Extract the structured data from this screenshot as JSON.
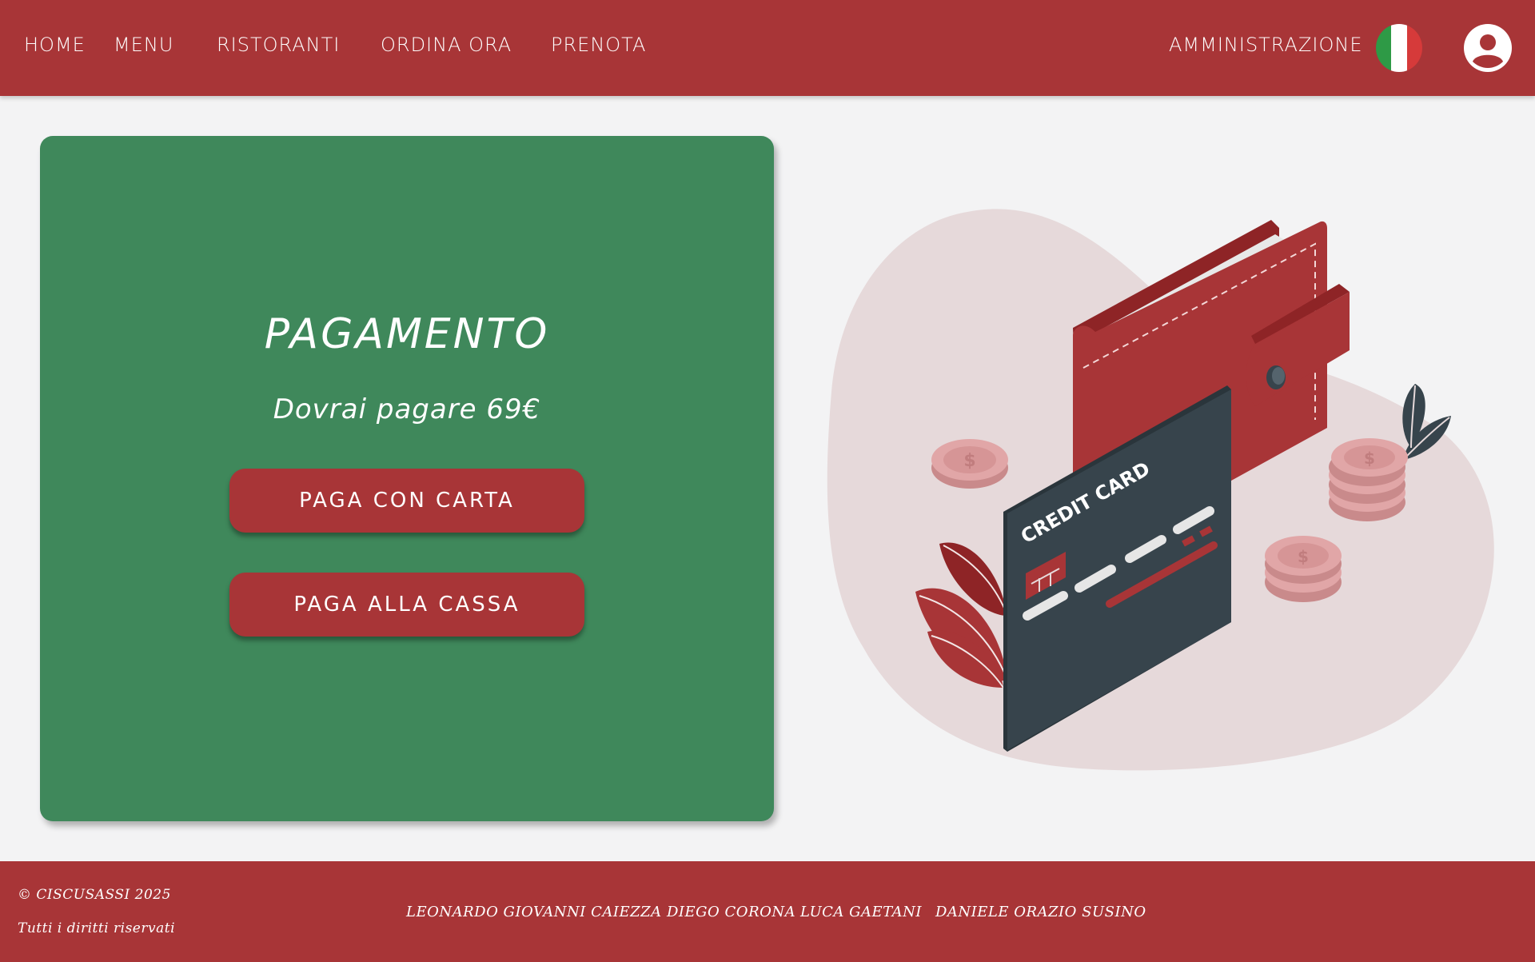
{
  "nav": {
    "links": [
      "HOME",
      "MENU",
      "RISTORANTI",
      "ORDINA ORA",
      "PRENOTA"
    ],
    "admin": "AMMINISTRAZIONE",
    "language_icon": "italian-flag-icon",
    "user_icon": "user-circle-icon"
  },
  "payment": {
    "title": "PAGAMENTO",
    "amount_text": "Dovrai pagare 69€",
    "card_button": "PAGA CON CARTA",
    "cashier_button": "PAGA ALLA CASSA"
  },
  "illustration": {
    "card_label": "CREDIT CARD",
    "coin_symbol": "$"
  },
  "footer": {
    "copyright": "© CISCUSASSI 2025",
    "rights": "Tutti i diritti riservati",
    "authors": [
      "LEONARDO GIOVANNI CAIEZZA",
      "DIEGO CORONA",
      "LUCA GAETANI",
      "DANIELE ORAZIO SUSINO"
    ]
  },
  "colors": {
    "brand_red": "#a83537",
    "panel_green": "#3f885b",
    "background": "#f3f3f4",
    "blob": "#e6d9da",
    "card_dark": "#37444c"
  }
}
